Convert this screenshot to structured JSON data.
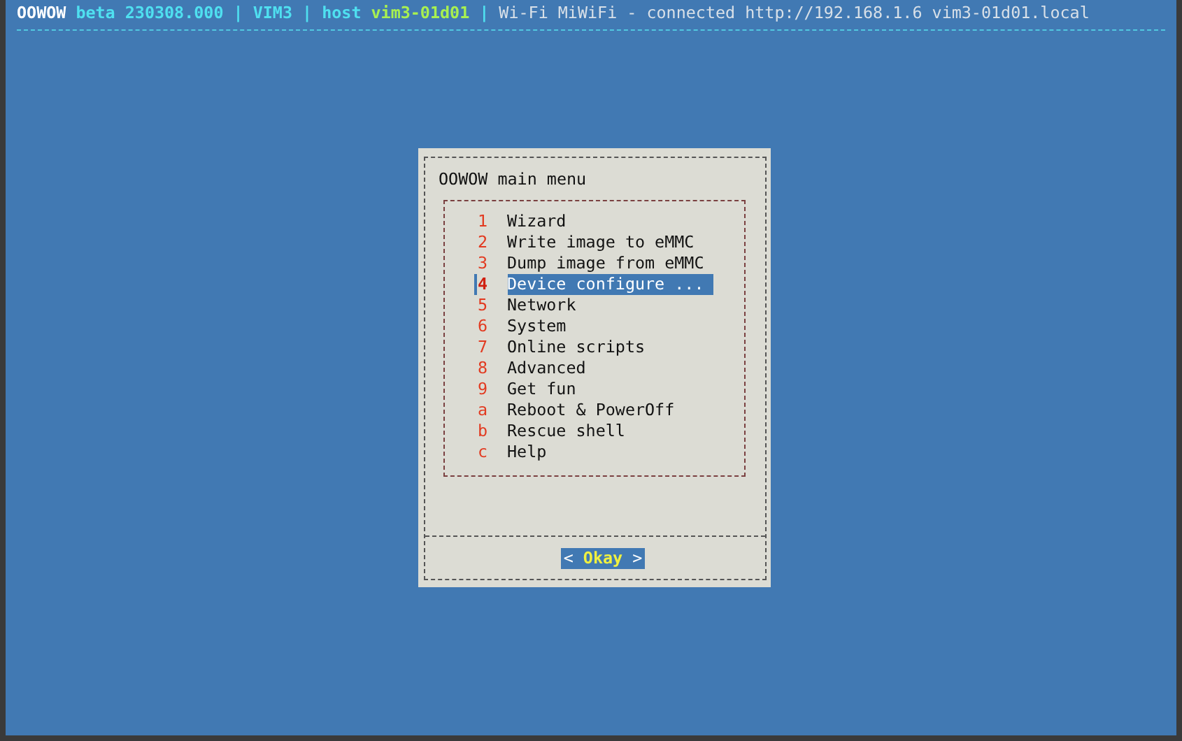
{
  "status_bar": {
    "segments": [
      {
        "kind": "brand",
        "text": "OOWOW"
      },
      {
        "kind": "info",
        "text": "beta 230308.000 | VIM3 | host"
      },
      {
        "kind": "host",
        "text": "vim3-01d01"
      },
      {
        "kind": "info",
        "text": "|"
      },
      {
        "kind": "plain",
        "text": "Wi-Fi MiWiFi - connected http://192.168.1.6 vim3-01d01.local"
      }
    ]
  },
  "dialog": {
    "title": "OOWOW main menu",
    "items": [
      {
        "key": "1",
        "label": "Wizard",
        "selected": false
      },
      {
        "key": "2",
        "label": "Write image to eMMC",
        "selected": false
      },
      {
        "key": "3",
        "label": "Dump image from eMMC",
        "selected": false
      },
      {
        "key": "4",
        "label": "Device configure ...",
        "selected": true
      },
      {
        "key": "5",
        "label": "Network",
        "selected": false
      },
      {
        "key": "6",
        "label": "System",
        "selected": false
      },
      {
        "key": "7",
        "label": "Online scripts",
        "selected": false
      },
      {
        "key": "8",
        "label": "Advanced",
        "selected": false
      },
      {
        "key": "9",
        "label": "Get fun",
        "selected": false
      },
      {
        "key": "a",
        "label": "Reboot & PowerOff",
        "selected": false
      },
      {
        "key": "b",
        "label": "Rescue shell",
        "selected": false
      },
      {
        "key": "c",
        "label": "Help",
        "selected": false
      }
    ],
    "buttons": [
      {
        "open": "<",
        "label": "Okay",
        "close": ">",
        "selected": true
      }
    ]
  }
}
